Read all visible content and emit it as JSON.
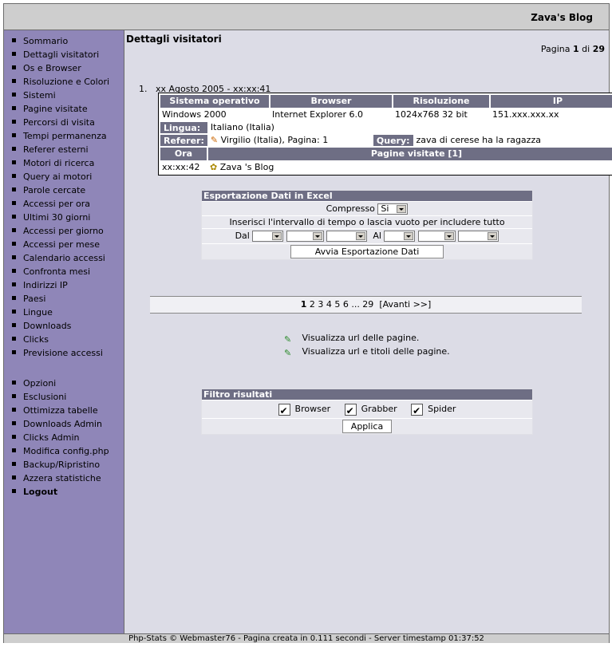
{
  "header": {
    "title": "Zava's Blog"
  },
  "sidebar": {
    "menu": [
      "Sommario",
      "Dettagli visitatori",
      "Os e Browser",
      "Risoluzione e Colori",
      "Sistemi",
      "Pagine visitate",
      "Percorsi di visita",
      "Tempi permanenza",
      "Referer esterni",
      "Motori di ricerca",
      "Query ai motori",
      "Parole cercate",
      "Accessi per ora",
      "Ultimi 30 giorni",
      "Accessi per giorno",
      "Accessi per mese",
      "Calendario accessi",
      "Confronta mesi",
      "Indirizzi IP",
      "Paesi",
      "Lingue",
      "Downloads",
      "Clicks",
      "Previsione accessi"
    ],
    "admin": [
      "Opzioni",
      "Esclusioni",
      "Ottimizza tabelle",
      "Downloads Admin",
      "Clicks Admin",
      "Modifica config.php",
      "Backup/Ripristino",
      "Azzera statistiche",
      "Logout"
    ]
  },
  "main": {
    "title": "Dettagli visitatori",
    "pagina_label": "Pagina",
    "pagina_current": "1",
    "pagina_of": "di",
    "pagina_total": "29",
    "entry": {
      "number": "1.",
      "datetime": "xx Agosto 2005 - xx:xx:41",
      "headers": [
        "Sistema operativo",
        "Browser",
        "Risoluzione",
        "IP"
      ],
      "os": "Windows 2000",
      "browser": "Internet Explorer 6.0",
      "resolution": "1024x768 32 bit",
      "ip": "151.xxx.xxx.xx",
      "lingua_label": "Lingua:",
      "lingua": "Italiano (Italia)",
      "referer_label": "Referer:",
      "referer": "Virgilio (Italia), Pagina: 1",
      "query_label": "Query:",
      "query": "zava di cerese ha la ragazza",
      "ora_label": "Ora",
      "pages_label": "Pagine visitate [1]",
      "ora": "xx:xx:42",
      "page": "Zava 's Blog"
    },
    "export": {
      "title": "Esportazione Dati in Excel",
      "compresso_label": "Compresso",
      "compresso_value": "Si",
      "hint": "Inserisci l'intervallo di tempo o lascia vuoto per includere tutto",
      "dal": "Dal",
      "al": "Al",
      "button": "Avvia Esportazione Dati"
    },
    "pager": {
      "current": "1",
      "pages": "2 3 4 5 6 ... 29",
      "next": "[Avanti >>]"
    },
    "links": [
      "Visualizza url delle pagine.",
      "Visualizza url e titoli delle pagine."
    ],
    "filter": {
      "title": "Filtro risultati",
      "options": [
        "Browser",
        "Grabber",
        "Spider"
      ],
      "button": "Applica"
    }
  },
  "footer": {
    "text": "Php-Stats © Webmaster76  - Pagina creata in 0.111 secondi - Server timestamp 01:37:52"
  },
  "colors": {
    "sidebar": "#8f86b8",
    "header_cell": "#6e6e84",
    "background": "#dcdce6"
  }
}
